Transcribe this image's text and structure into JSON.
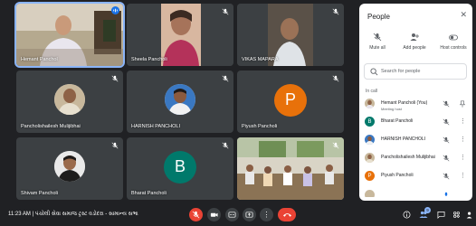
{
  "tiles": [
    {
      "name": "Hemant Panchol"
    },
    {
      "name": "Sheela Pancholi"
    },
    {
      "name": "VIKAS MAPARA"
    },
    {
      "name": "Pancholishailesh Mulijibhai"
    },
    {
      "name": "HARNISH PANCHOLI"
    },
    {
      "name": "Piyush Pancholi",
      "initial": "P"
    },
    {
      "name": "Shivam Pancholi"
    },
    {
      "name": "Bharat Pancholi",
      "initial": "B"
    },
    {
      "name": ""
    }
  ],
  "panel": {
    "title": "People",
    "tools": {
      "mute_all": "Mute all",
      "add_people": "Add people",
      "host_controls": "Host controls"
    },
    "search_placeholder": "Search for people",
    "in_call": "In call",
    "people": [
      {
        "name": "Hemant Pancholi (You)",
        "sub": "Meeting host"
      },
      {
        "name": "Bharat Pancholi",
        "initial": "B"
      },
      {
        "name": "HARNISH PANCHOLI"
      },
      {
        "name": "Pancholishailesh Mulijibhai"
      },
      {
        "name": "Piyush Pancholi",
        "initial": "P"
      }
    ]
  },
  "bottom": {
    "time_and_title": "11:23 AM | પંચોલી સેવા સમાજ ટ્રસ્ટ વડોદરા - સામાન્ય સભા",
    "participants_badge": "9"
  },
  "colors": {
    "background": "#202124",
    "tile": "#3c4043",
    "accent_blue": "#8ab4f8",
    "red": "#ea4335",
    "avatar_teal": "#00796b",
    "avatar_orange": "#e8710a"
  }
}
